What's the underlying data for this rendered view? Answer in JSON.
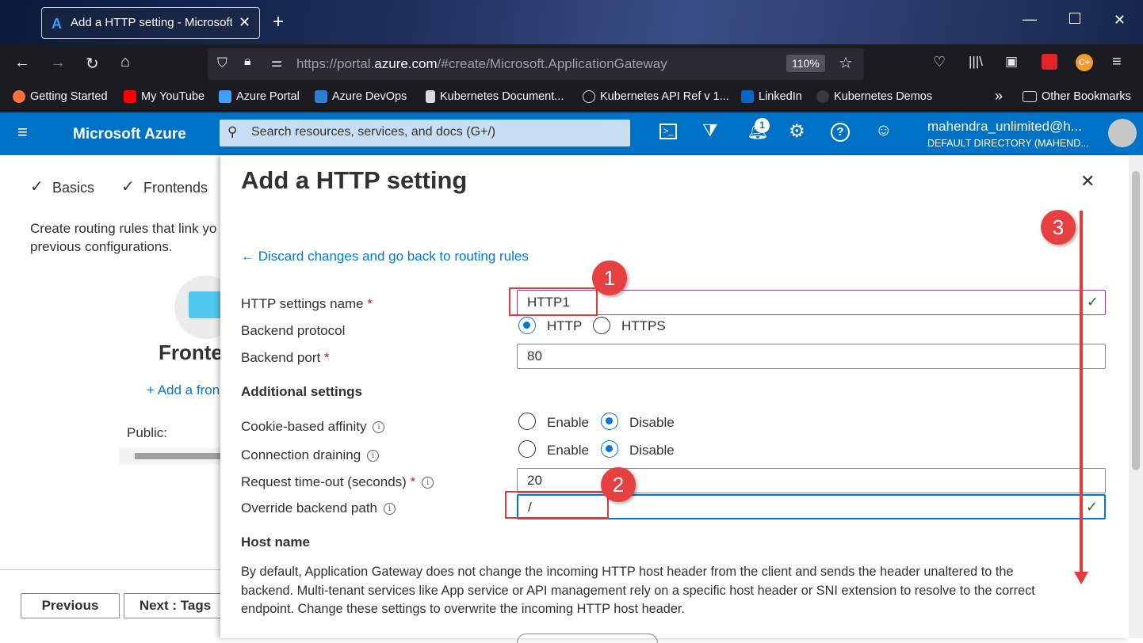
{
  "browser": {
    "tab_title": "Add a HTTP setting - Microsoft",
    "url_prefix": "https://portal.",
    "url_domain": "azure.com",
    "url_path": "/#create/Microsoft.ApplicationGateway",
    "zoom": "110%",
    "bookmarks": [
      "Getting Started",
      "My YouTube",
      "Azure Portal",
      "Azure DevOps",
      "Kubernetes Document...",
      "Kubernetes API Ref v 1...",
      "LinkedIn",
      "Kubernetes Demos"
    ],
    "other_bookmarks": "Other Bookmarks"
  },
  "azure": {
    "brand": "Microsoft Azure",
    "search_placeholder": "Search resources, services, and docs (G+/)",
    "notification_count": "1",
    "user_name": "mahendra_unlimited@h...",
    "user_directory": "DEFAULT DIRECTORY (MAHEND..."
  },
  "background": {
    "step_basics": "Basics",
    "step_frontends": "Frontends",
    "description_line1": "Create routing rules that link yo",
    "description_line2": "previous configurations.",
    "frontend_title": "Fronte",
    "add_frontend": "+ Add a fron",
    "public_label": "Public:",
    "previous_button": "Previous",
    "next_button": "Next : Tags"
  },
  "panel": {
    "title": "Add a HTTP setting",
    "discard_link": "← Discard changes and go back to routing rules",
    "http_settings_name_label": "HTTP settings name",
    "http_settings_name_value": "HTTP1",
    "backend_protocol_label": "Backend protocol",
    "protocol_options": [
      "HTTP",
      "HTTPS"
    ],
    "protocol_selected": "HTTP",
    "backend_port_label": "Backend port",
    "backend_port_value": "80",
    "additional_settings_heading": "Additional settings",
    "cookie_affinity_label": "Cookie-based affinity",
    "connection_draining_label": "Connection draining",
    "enable_label": "Enable",
    "disable_label": "Disable",
    "cookie_affinity_selected": "Disable",
    "connection_draining_selected": "Disable",
    "request_timeout_label": "Request time-out (seconds)",
    "request_timeout_value": "20",
    "override_path_label": "Override backend path",
    "override_path_value": "/",
    "host_name_heading": "Host name",
    "host_name_desc_line1": "By default, Application Gateway does not change the incoming HTTP host header from the client and sends the header unaltered to the",
    "host_name_desc_line2": "backend. Multi-tenant services like App service or API management rely on a specific host header or SNI extension to resolve to the correct",
    "host_name_desc_line3": "endpoint. Change these settings to overwrite the incoming HTTP host header."
  },
  "annotations": [
    "1",
    "2",
    "3"
  ],
  "colors": {
    "azure_blue": "#0072c6",
    "link": "#0078d4",
    "marker_red": "#e74040",
    "valid_green": "#107c10"
  }
}
